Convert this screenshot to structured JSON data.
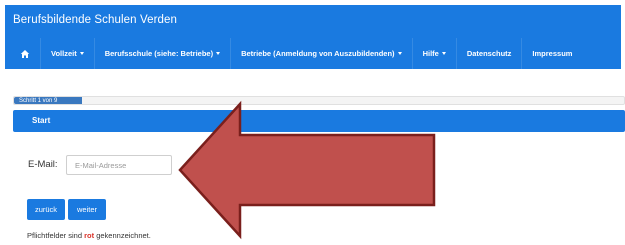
{
  "header": {
    "site_title": "Berufsbildende Schulen Verden"
  },
  "nav": {
    "home_icon": "home-icon",
    "items": [
      {
        "label": "Vollzeit",
        "has_dropdown": true
      },
      {
        "label": "Berufsschule (siehe: Betriebe)",
        "has_dropdown": true
      },
      {
        "label": "Betriebe (Anmeldung von Auszubildenden)",
        "has_dropdown": true
      },
      {
        "label": "Hilfe",
        "has_dropdown": true
      },
      {
        "label": "Datenschutz",
        "has_dropdown": false
      },
      {
        "label": "Impressum",
        "has_dropdown": false
      }
    ]
  },
  "progress": {
    "label": "Schritt 1 von 9",
    "current": 1,
    "total": 9
  },
  "section": {
    "title": "Start"
  },
  "form": {
    "email_label": "E-Mail:",
    "email_placeholder": "E-Mail-Adresse",
    "email_value": ""
  },
  "buttons": {
    "back_label": "zurück",
    "next_label": "weiter"
  },
  "hint": {
    "prefix": "Pflichtfelder sind ",
    "required_word": "rot",
    "suffix": " gekennzeichnet."
  },
  "colors": {
    "brand": "#1a7ae0",
    "progress": "#3a78bf",
    "required": "#d9342b",
    "annotation_arrow": "#c0504d"
  },
  "annotation": {
    "icon": "left-arrow-annotation-icon"
  }
}
